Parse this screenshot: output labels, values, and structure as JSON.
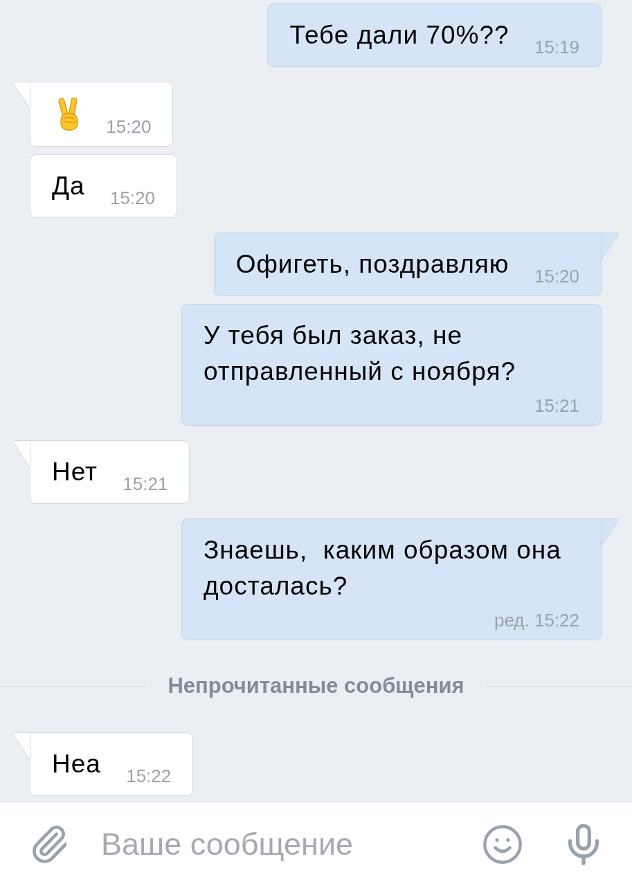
{
  "messages": [
    {
      "kind": "text",
      "outgoing": true,
      "tail": false,
      "text": "Тебе дали 70%??",
      "time": "15:19"
    },
    {
      "kind": "emoji",
      "outgoing": false,
      "tail": true,
      "time": "15:20"
    },
    {
      "kind": "text",
      "outgoing": false,
      "tail": false,
      "text": "Да",
      "time": "15:20"
    },
    {
      "kind": "text",
      "outgoing": true,
      "tail": true,
      "text": "Офигеть, поздравляю",
      "time": "15:20"
    },
    {
      "kind": "text",
      "outgoing": true,
      "tail": false,
      "text": "У тебя был заказ, не отправленный с ноября?",
      "time": "15:21"
    },
    {
      "kind": "text",
      "outgoing": false,
      "tail": true,
      "text": "Нет",
      "time": "15:21"
    },
    {
      "kind": "text",
      "outgoing": true,
      "tail": true,
      "text": "Знаешь,  каким образом она досталась?",
      "time": "ред. 15:22"
    },
    {
      "kind": "divider",
      "label": "Непрочитанные сообщения"
    },
    {
      "kind": "text",
      "outgoing": false,
      "tail": true,
      "text": "Неа",
      "time": "15:22"
    }
  ],
  "composer": {
    "placeholder": "Ваше сообщение"
  }
}
